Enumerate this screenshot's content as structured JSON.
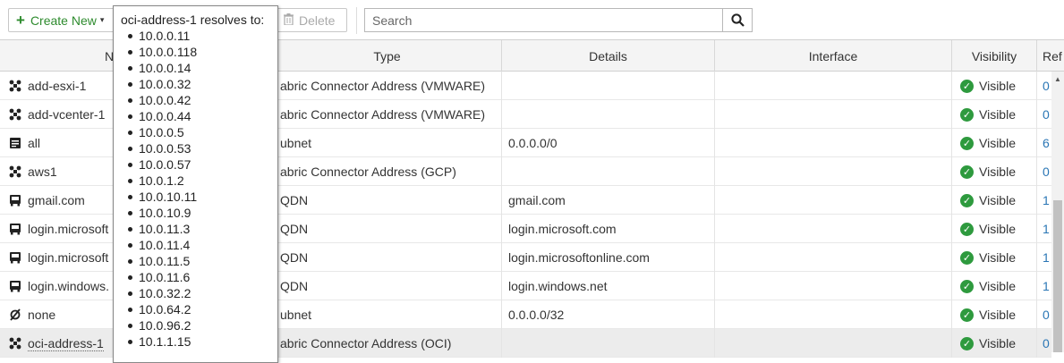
{
  "toolbar": {
    "create_label": "Create New",
    "delete_label": "Delete",
    "search_placeholder": "Search"
  },
  "columns": [
    "Name",
    "Type",
    "Details",
    "Interface",
    "Visibility",
    "Ref"
  ],
  "columns_shown": {
    "name": "N",
    "type": "Type",
    "details": "Details",
    "interface": "Interface",
    "visibility": "Visibility",
    "ref": "Ref"
  },
  "rows": [
    {
      "name": "add-esxi-1",
      "icon": "fabric-connector-icon",
      "type": "abric Connector Address (VMWARE)",
      "details": "",
      "interface": "",
      "visibility": "Visible",
      "ref": "0"
    },
    {
      "name": "add-vcenter-1",
      "icon": "fabric-connector-icon",
      "type": "abric Connector Address (VMWARE)",
      "details": "",
      "interface": "",
      "visibility": "Visible",
      "ref": "0"
    },
    {
      "name": "all",
      "icon": "subnet-icon",
      "type": "ubnet",
      "details": "0.0.0.0/0",
      "interface": "",
      "visibility": "Visible",
      "ref": "6"
    },
    {
      "name": "aws1",
      "icon": "fabric-connector-icon",
      "type": "abric Connector Address (GCP)",
      "details": "",
      "interface": "",
      "visibility": "Visible",
      "ref": "0"
    },
    {
      "name": "gmail.com",
      "icon": "fqdn-icon",
      "type": "QDN",
      "details": "gmail.com",
      "interface": "",
      "visibility": "Visible",
      "ref": "1"
    },
    {
      "name": "login.microsoft",
      "icon": "fqdn-icon",
      "type": "QDN",
      "details": "login.microsoft.com",
      "interface": "",
      "visibility": "Visible",
      "ref": "1"
    },
    {
      "name": "login.microsoft",
      "icon": "fqdn-icon",
      "type": "QDN",
      "details": "login.microsoftonline.com",
      "interface": "",
      "visibility": "Visible",
      "ref": "1"
    },
    {
      "name": "login.windows.",
      "icon": "fqdn-icon",
      "type": "QDN",
      "details": "login.windows.net",
      "interface": "",
      "visibility": "Visible",
      "ref": "1"
    },
    {
      "name": "none",
      "icon": "none-address-icon",
      "type": "ubnet",
      "details": "0.0.0.0/32",
      "interface": "",
      "visibility": "Visible",
      "ref": "0"
    },
    {
      "name": "oci-address-1",
      "icon": "fabric-connector-icon",
      "type": "abric Connector Address (OCI)",
      "details": "",
      "interface": "",
      "visibility": "Visible",
      "ref": "0"
    }
  ],
  "tooltip": {
    "title": "oci-address-1 resolves to:",
    "addresses": [
      "10.0.0.11",
      "10.0.0.118",
      "10.0.0.14",
      "10.0.0.32",
      "10.0.0.42",
      "10.0.0.44",
      "10.0.0.5",
      "10.0.0.53",
      "10.0.0.57",
      "10.0.1.2",
      "10.0.10.11",
      "10.0.10.9",
      "10.0.11.3",
      "10.0.11.4",
      "10.0.11.5",
      "10.0.11.6",
      "10.0.32.2",
      "10.0.64.2",
      "10.0.96.2",
      "10.1.1.15"
    ]
  },
  "colors": {
    "create_green": "#2e8b2e",
    "visible_green": "#2e9a3e",
    "ref_link": "#2a76b5"
  }
}
